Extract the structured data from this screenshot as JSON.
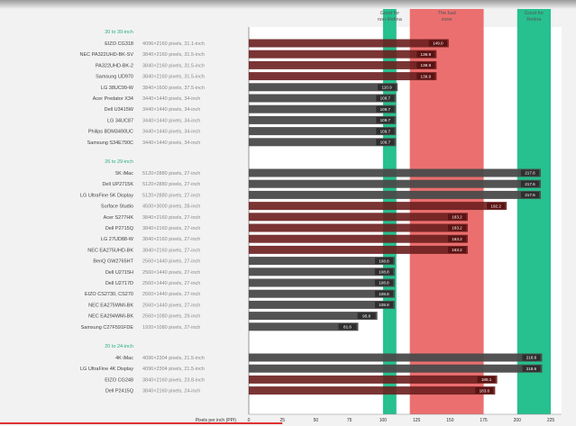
{
  "chart_data": {
    "type": "bar",
    "orientation": "horizontal",
    "xlabel": "Pixels per inch (PPI)",
    "xlim": [
      0,
      225
    ],
    "x_ticks": [
      0,
      25,
      50,
      75,
      100,
      125,
      150,
      175,
      200,
      225
    ],
    "zones": [
      {
        "label": "Good for non-Retina",
        "from": 100,
        "to": 110,
        "color": "#27c08f"
      },
      {
        "label": "The bad zone",
        "from": 120,
        "to": 175,
        "color": "#ec6f6f"
      },
      {
        "label": "Good for Retina",
        "from": 200,
        "to": 225,
        "color": "#27c08f"
      }
    ],
    "colors": {
      "bar": "#4a4a4a",
      "value_box": "#2e2e2e",
      "bar_hot": "#6b1e1e",
      "value_box_hot": "#5a1212"
    },
    "groups": [
      {
        "title": "30 to 39-inch",
        "rows": [
          {
            "model": "EIZO CG318",
            "spec": "4096×2160 pixels, 31.1-inch",
            "value": 149.0,
            "label": "149.0"
          },
          {
            "model": "NEC PA322UHD-BK-SV",
            "spec": "3840×2160 pixels, 31.5-inch",
            "value": 139.9,
            "label": "139.9"
          },
          {
            "model": "PA322UHD-BK-2",
            "spec": "3840×2160 pixels, 31.5-inch",
            "value": 139.9,
            "label": "139.9"
          },
          {
            "model": "Samsung UD970",
            "spec": "3840×2160 pixels, 31.5-inch",
            "value": 139.9,
            "label": "139.9"
          },
          {
            "model": "LG 38UC99-W",
            "spec": "3840×1600 pixels, 37.5-inch",
            "value": 110.9,
            "label": "110.9"
          },
          {
            "model": "Acer Predator X34",
            "spec": "3440×1440 pixels, 34-inch",
            "value": 109.7,
            "label": "109.7"
          },
          {
            "model": "Dell U3415W",
            "spec": "3440×1440 pixels, 34-inch",
            "value": 109.7,
            "label": "109.7"
          },
          {
            "model": "LG 34UC87",
            "spec": "3440×1440 pixels, 34-inch",
            "value": 109.7,
            "label": "109.7"
          },
          {
            "model": "Philips BDM3490UC",
            "spec": "3440×1440 pixels, 34-inch",
            "value": 109.7,
            "label": "109.7"
          },
          {
            "model": "Samsung S34E790C",
            "spec": "3440×1440 pixels, 34-inch",
            "value": 109.7,
            "label": "109.7"
          }
        ]
      },
      {
        "title": "26 to 29-inch",
        "rows": [
          {
            "model": "5K iMac",
            "spec": "5120×2880 pixels, 27-inch",
            "value": 217.6,
            "label": "217.6"
          },
          {
            "model": "Dell UP2715K",
            "spec": "5120×2880 pixels, 27-inch",
            "value": 217.6,
            "label": "217.6"
          },
          {
            "model": "LG UltraFine 5K Display",
            "spec": "5120×2880 pixels, 27-inch",
            "value": 217.6,
            "label": "217.6"
          },
          {
            "model": "Surface Studio",
            "spec": "4500×3000 pixels, 28-inch",
            "value": 192.2,
            "label": "192.2"
          },
          {
            "model": "Acer S277HK",
            "spec": "3840×2160 pixels, 27-inch",
            "value": 163.2,
            "label": "163.2"
          },
          {
            "model": "Dell P2715Q",
            "spec": "3840×2160 pixels, 27-inch",
            "value": 163.2,
            "label": "163.2"
          },
          {
            "model": "LG 27UD88-W",
            "spec": "3840×2160 pixels, 27-inch",
            "value": 163.2,
            "label": "163.2"
          },
          {
            "model": "NEC EA275UHD-BK",
            "spec": "3840×2160 pixels, 27-inch",
            "value": 163.2,
            "label": "163.2"
          },
          {
            "model": "BenQ GW2765HT",
            "spec": "2560×1440 pixels, 27-inch",
            "value": 108.8,
            "label": "108.8"
          },
          {
            "model": "Dell U2715H",
            "spec": "2560×1440 pixels, 27-inch",
            "value": 108.8,
            "label": "108.8"
          },
          {
            "model": "Dell U2717D",
            "spec": "2560×1440 pixels, 27-inch",
            "value": 108.8,
            "label": "108.8"
          },
          {
            "model": "EIZO CS2730, CS270",
            "spec": "2560×1440 pixels, 27-inch",
            "value": 108.8,
            "label": "108.8"
          },
          {
            "model": "NEC EA275WMi-BK",
            "spec": "2560×1440 pixels, 27-inch",
            "value": 108.8,
            "label": "108.8"
          },
          {
            "model": "NEC EA294WMi-BK",
            "spec": "2560×1080 pixels, 29-inch",
            "value": 95.8,
            "label": "95.8"
          },
          {
            "model": "Samsung C27F591FDE",
            "spec": "1920×1080 pixels, 27-inch",
            "value": 81.6,
            "label": "81.6"
          }
        ]
      },
      {
        "title": "20 to 24-inch",
        "rows": [
          {
            "model": "4K iMac",
            "spec": "4096×2304 pixels, 21.5-inch",
            "value": 218.6,
            "label": "218.6"
          },
          {
            "model": "LG UltraFine 4K Display",
            "spec": "4096×2304 pixels, 21.5-inch",
            "value": 218.6,
            "label": "218.6"
          },
          {
            "model": "EIZO CG248",
            "spec": "3840×2160 pixels, 23.8-inch",
            "value": 185.1,
            "label": "185.1"
          },
          {
            "model": "Dell P2415Q",
            "spec": "3840×2160 pixels, 24-inch",
            "value": 183.6,
            "label": "183.6"
          }
        ]
      }
    ]
  }
}
